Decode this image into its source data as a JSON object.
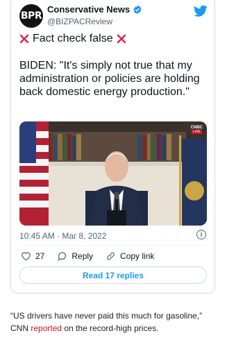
{
  "tweet": {
    "avatar_text": "BPR",
    "author_name": "Conservative News",
    "handle": "@BIZPACReview",
    "fact_check_label": "Fact check false",
    "quote": "BIDEN: \"It's simply not true that my administration or policies are holding back domestic energy production.\"",
    "timestamp": "10:45 AM · Mar 8, 2022",
    "actions": {
      "likes_count": "27",
      "reply_label": "Reply",
      "copy_link_label": "Copy link"
    },
    "read_replies_label": "Read 17 replies",
    "media": {
      "network_logo": "CNBC",
      "live_label": "LIVE"
    }
  },
  "article": {
    "quote": "“US drivers have never paid this much for gasoline,”",
    "source": "CNN",
    "link_text": "reported",
    "rest": "on the record-high prices."
  },
  "colors": {
    "accent": "#1d9bf0",
    "fact_check_x": "#e0245e",
    "link": "#c4161c"
  },
  "icons": [
    "verified-badge-icon",
    "twitter-bird-icon",
    "x-mark-icon",
    "info-icon",
    "heart-icon",
    "reply-icon",
    "link-icon"
  ]
}
